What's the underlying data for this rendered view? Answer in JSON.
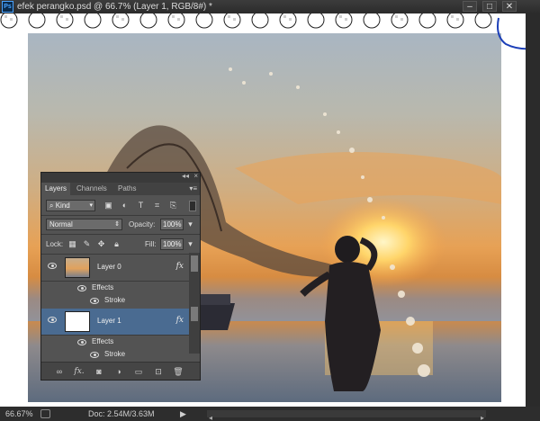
{
  "window": {
    "title": "efek perangko.psd @ 66.7% (Layer 1, RGB/8#) *",
    "app_icon": "Ps",
    "minimize": "–",
    "restore": "□",
    "close": "✕"
  },
  "status": {
    "zoom": "66.67%",
    "doc": "Doc: 2.54M/3.63M",
    "arrow": "▶"
  },
  "layers_panel": {
    "collapse": "◂◂",
    "close": "×",
    "tabs": [
      {
        "label": "Layers",
        "active": true
      },
      {
        "label": "Channels",
        "active": false
      },
      {
        "label": "Paths",
        "active": false
      }
    ],
    "filter": {
      "label": "Kind",
      "icon": "search-icon"
    },
    "blend_mode": "Normal",
    "opacity_label": "Opacity:",
    "opacity_value": "100%",
    "lock_label": "Lock:",
    "fill_label": "Fill:",
    "fill_value": "100%",
    "layers": [
      {
        "name": "Layer 0",
        "selected": false,
        "fx": "fx",
        "effects_label": "Effects",
        "effect": "Stroke"
      },
      {
        "name": "Layer 1",
        "selected": true,
        "fx": "fx",
        "effects_label": "Effects",
        "effect": "Stroke"
      }
    ],
    "bottom_icons": [
      "link-icon",
      "fx-icon",
      "mask-icon",
      "adjustment-icon",
      "group-folder-icon",
      "new-layer-icon",
      "trash-icon"
    ],
    "fx_bottom": "fx."
  },
  "colors": {
    "panel_bg": "#535353",
    "selected_layer": "#4a6b91",
    "titlebar": "#2b2b2b",
    "blue_annotation": "#1c3fb8"
  }
}
